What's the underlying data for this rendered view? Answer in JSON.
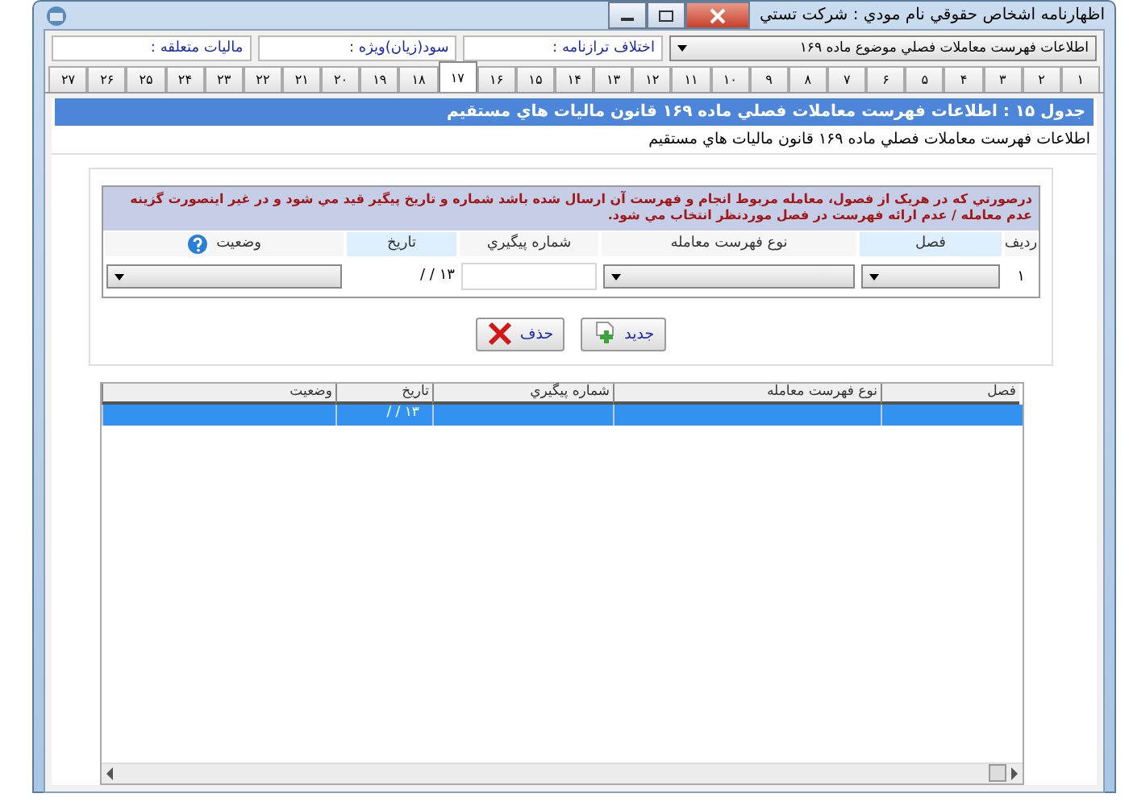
{
  "window": {
    "title": "اظهارنامه اشخاص حقوقي   نام مودي : شرکت تستي"
  },
  "toolbar": {
    "dropdown": {
      "value": "اطلاعات فهرست معاملات فصلي موضوع ماده ۱۶۹"
    },
    "fields": [
      {
        "label": "اختلاف ترازنامه :"
      },
      {
        "label": "سود(زيان)ويژه :"
      },
      {
        "label": "ماليات متعلقه :"
      }
    ]
  },
  "tabs": [
    {
      "label": "۱",
      "selected": false
    },
    {
      "label": "۲",
      "selected": false
    },
    {
      "label": "۳",
      "selected": false
    },
    {
      "label": "۴",
      "selected": false
    },
    {
      "label": "۵",
      "selected": false
    },
    {
      "label": "۶",
      "selected": false
    },
    {
      "label": "۷",
      "selected": false
    },
    {
      "label": "۸",
      "selected": false
    },
    {
      "label": "۹",
      "selected": false
    },
    {
      "label": "۱۰",
      "selected": false
    },
    {
      "label": "۱۱",
      "selected": false
    },
    {
      "label": "۱۲",
      "selected": false
    },
    {
      "label": "۱۳",
      "selected": false
    },
    {
      "label": "۱۴",
      "selected": false
    },
    {
      "label": "۱۵",
      "selected": false
    },
    {
      "label": "۱۶",
      "selected": false
    },
    {
      "label": "۱۷",
      "selected": true
    },
    {
      "label": "۱۸",
      "selected": false
    },
    {
      "label": "۱۹",
      "selected": false
    },
    {
      "label": "۲۰",
      "selected": false
    },
    {
      "label": "۲۱",
      "selected": false
    },
    {
      "label": "۲۲",
      "selected": false
    },
    {
      "label": "۲۳",
      "selected": false
    },
    {
      "label": "۲۴",
      "selected": false
    },
    {
      "label": "۲۵",
      "selected": false
    },
    {
      "label": "۲۶",
      "selected": false
    },
    {
      "label": "۲۷",
      "selected": false
    }
  ],
  "section": {
    "title": "جدول ۱۵ : اطلاعات فهرست معاملات فصلي ماده ۱۶۹ قانون ماليات هاي مستقيم",
    "subtitle": "اطلاعات فهرست معاملات فصلي ماده ۱۶۹ قانون ماليات هاي مستقيم"
  },
  "form": {
    "notice": "درصورتي که در هريک از فصول، معامله مربوط انجام و فهرست آن ارسال شده باشد شماره و تاريخ پيگير قيد مي شود و در غير اينصورت گزينه عدم معامله / عدم ارائه فهرست در فصل موردنظر انتخاب مي شود.",
    "columns": [
      {
        "label": "رديف",
        "kind": "index",
        "highlighted": false
      },
      {
        "label": "فصل",
        "kind": "select",
        "highlighted": true
      },
      {
        "label": "نوع فهرست معامله",
        "kind": "select",
        "highlighted": false
      },
      {
        "label": "شماره پيگيري",
        "kind": "text",
        "highlighted": false
      },
      {
        "label": "تاريخ",
        "kind": "date",
        "highlighted": true
      },
      {
        "label": "وضعيت",
        "kind": "status",
        "highlighted": false
      }
    ],
    "rows": [
      {
        "number": "۱",
        "date": "۱۳ / /"
      }
    ]
  },
  "buttons": [
    {
      "label": "جديد",
      "kind": "add"
    },
    {
      "label": "حذف",
      "kind": "delete"
    }
  ],
  "list": {
    "columns": [
      "فصل",
      "نوع فهرست معامله",
      "شماره پيگيري",
      "تاريخ",
      "وضعيت"
    ],
    "rows": [
      {
        "selected": true,
        "cells": [
          "",
          "",
          "",
          "۱۳ / /",
          ""
        ]
      }
    ]
  }
}
